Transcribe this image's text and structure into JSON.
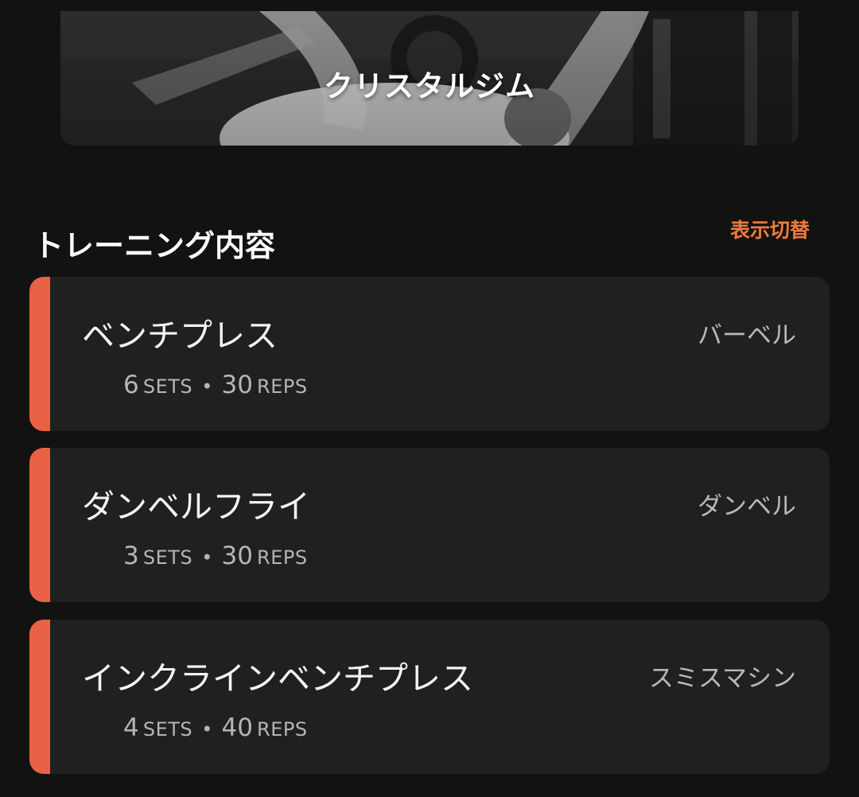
{
  "hero": {
    "title": "クリスタルジム"
  },
  "section": {
    "title": "トレーニング内容",
    "toggle_label": "表示切替"
  },
  "exercises": [
    {
      "name": "ベンチプレス",
      "equipment": "バーベル",
      "sets": "6",
      "sets_unit": "SETS",
      "separator": "•",
      "reps": "30",
      "reps_unit": "REPS"
    },
    {
      "name": "ダンベルフライ",
      "equipment": "ダンベル",
      "sets": "3",
      "sets_unit": "SETS",
      "separator": "•",
      "reps": "30",
      "reps_unit": "REPS"
    },
    {
      "name": "インクラインベンチプレス",
      "equipment": "スミスマシン",
      "sets": "4",
      "sets_unit": "SETS",
      "separator": "•",
      "reps": "40",
      "reps_unit": "REPS"
    }
  ],
  "colors": {
    "background": "#121212",
    "card": "#202020",
    "accent_bar": "#ea6246",
    "link": "#f07a3c"
  }
}
